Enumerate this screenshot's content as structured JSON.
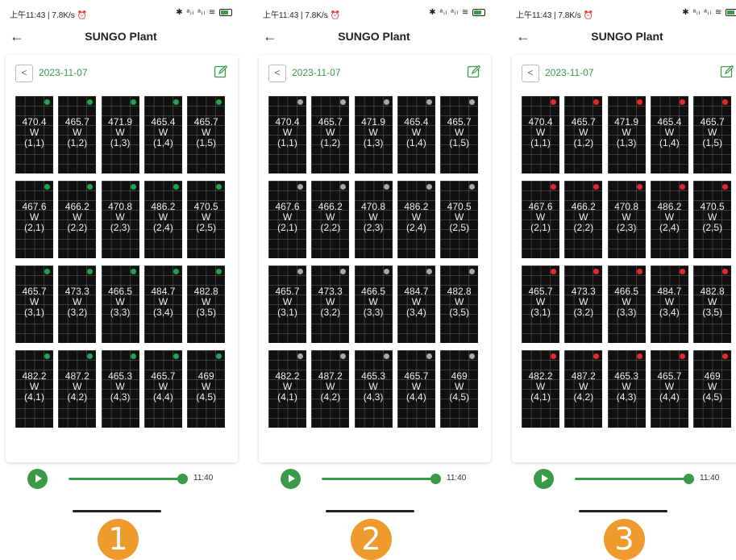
{
  "status": {
    "time_speed": "上午11:43 | 7.8K/s ⏰",
    "signal_text": "✱ ᵃᵢₗ ᵃᵢₗ ≋"
  },
  "header": {
    "title": "SUNGO Plant",
    "back_icon": "←"
  },
  "date": {
    "value": "2023-11-07",
    "prev_icon": "<"
  },
  "player": {
    "time": "11:40",
    "progress": 1.0
  },
  "colors": {
    "accent": "#3a9a49",
    "online": "#1fa552",
    "offline": "#a8a8a8",
    "alarm": "#e8282c",
    "badge": "#ee9a2d"
  },
  "screens": [
    {
      "badge": "1",
      "dot_color": "#1fa552",
      "panels": [
        {
          "power": "470.4",
          "unit": "W",
          "pos": "(1,1)"
        },
        {
          "power": "465.7",
          "unit": "W",
          "pos": "(1,2)"
        },
        {
          "power": "471.9",
          "unit": "W",
          "pos": "(1,3)"
        },
        {
          "power": "465.4",
          "unit": "W",
          "pos": "(1,4)"
        },
        {
          "power": "465.7",
          "unit": "W",
          "pos": "(1,5)"
        },
        {
          "power": "467.6",
          "unit": "W",
          "pos": "(2,1)"
        },
        {
          "power": "466.2",
          "unit": "W",
          "pos": "(2,2)"
        },
        {
          "power": "470.8",
          "unit": "W",
          "pos": "(2,3)"
        },
        {
          "power": "486.2",
          "unit": "W",
          "pos": "(2,4)"
        },
        {
          "power": "470.5",
          "unit": "W",
          "pos": "(2,5)"
        },
        {
          "power": "465.7",
          "unit": "W",
          "pos": "(3,1)"
        },
        {
          "power": "473.3",
          "unit": "W",
          "pos": "(3,2)"
        },
        {
          "power": "466.5",
          "unit": "W",
          "pos": "(3,3)"
        },
        {
          "power": "484.7",
          "unit": "W",
          "pos": "(3,4)"
        },
        {
          "power": "482.8",
          "unit": "W",
          "pos": "(3,5)"
        },
        {
          "power": "482.2",
          "unit": "W",
          "pos": "(4,1)"
        },
        {
          "power": "487.2",
          "unit": "W",
          "pos": "(4,2)"
        },
        {
          "power": "465.3",
          "unit": "W",
          "pos": "(4,3)"
        },
        {
          "power": "465.7",
          "unit": "W",
          "pos": "(4,4)"
        },
        {
          "power": "469",
          "unit": "W",
          "pos": "(4,5)"
        }
      ]
    },
    {
      "badge": "2",
      "dot_color": "#a8a8a8",
      "panels": [
        {
          "power": "470.4",
          "unit": "W",
          "pos": "(1,1)"
        },
        {
          "power": "465.7",
          "unit": "W",
          "pos": "(1,2)"
        },
        {
          "power": "471.9",
          "unit": "W",
          "pos": "(1,3)"
        },
        {
          "power": "465.4",
          "unit": "W",
          "pos": "(1,4)"
        },
        {
          "power": "465.7",
          "unit": "W",
          "pos": "(1,5)"
        },
        {
          "power": "467.6",
          "unit": "W",
          "pos": "(2,1)"
        },
        {
          "power": "466.2",
          "unit": "W",
          "pos": "(2,2)"
        },
        {
          "power": "470.8",
          "unit": "W",
          "pos": "(2,3)"
        },
        {
          "power": "486.2",
          "unit": "W",
          "pos": "(2,4)"
        },
        {
          "power": "470.5",
          "unit": "W",
          "pos": "(2,5)"
        },
        {
          "power": "465.7",
          "unit": "W",
          "pos": "(3,1)"
        },
        {
          "power": "473.3",
          "unit": "W",
          "pos": "(3,2)"
        },
        {
          "power": "466.5",
          "unit": "W",
          "pos": "(3,3)"
        },
        {
          "power": "484.7",
          "unit": "W",
          "pos": "(3,4)"
        },
        {
          "power": "482.8",
          "unit": "W",
          "pos": "(3,5)"
        },
        {
          "power": "482.2",
          "unit": "W",
          "pos": "(4,1)"
        },
        {
          "power": "487.2",
          "unit": "W",
          "pos": "(4,2)"
        },
        {
          "power": "465.3",
          "unit": "W",
          "pos": "(4,3)"
        },
        {
          "power": "465.7",
          "unit": "W",
          "pos": "(4,4)"
        },
        {
          "power": "469",
          "unit": "W",
          "pos": "(4,5)"
        }
      ]
    },
    {
      "badge": "3",
      "dot_color": "#e8282c",
      "panels": [
        {
          "power": "470.4",
          "unit": "W",
          "pos": "(1,1)"
        },
        {
          "power": "465.7",
          "unit": "W",
          "pos": "(1,2)"
        },
        {
          "power": "471.9",
          "unit": "W",
          "pos": "(1,3)"
        },
        {
          "power": "465.4",
          "unit": "W",
          "pos": "(1,4)"
        },
        {
          "power": "465.7",
          "unit": "W",
          "pos": "(1,5)"
        },
        {
          "power": "467.6",
          "unit": "W",
          "pos": "(2,1)"
        },
        {
          "power": "466.2",
          "unit": "W",
          "pos": "(2,2)"
        },
        {
          "power": "470.8",
          "unit": "W",
          "pos": "(2,3)"
        },
        {
          "power": "486.2",
          "unit": "W",
          "pos": "(2,4)"
        },
        {
          "power": "470.5",
          "unit": "W",
          "pos": "(2,5)"
        },
        {
          "power": "465.7",
          "unit": "W",
          "pos": "(3,1)"
        },
        {
          "power": "473.3",
          "unit": "W",
          "pos": "(3,2)"
        },
        {
          "power": "466.5",
          "unit": "W",
          "pos": "(3,3)"
        },
        {
          "power": "484.7",
          "unit": "W",
          "pos": "(3,4)"
        },
        {
          "power": "482.8",
          "unit": "W",
          "pos": "(3,5)"
        },
        {
          "power": "482.2",
          "unit": "W",
          "pos": "(4,1)"
        },
        {
          "power": "487.2",
          "unit": "W",
          "pos": "(4,2)"
        },
        {
          "power": "465.3",
          "unit": "W",
          "pos": "(4,3)"
        },
        {
          "power": "465.7",
          "unit": "W",
          "pos": "(4,4)"
        },
        {
          "power": "469",
          "unit": "W",
          "pos": "(4,5)"
        }
      ]
    }
  ]
}
